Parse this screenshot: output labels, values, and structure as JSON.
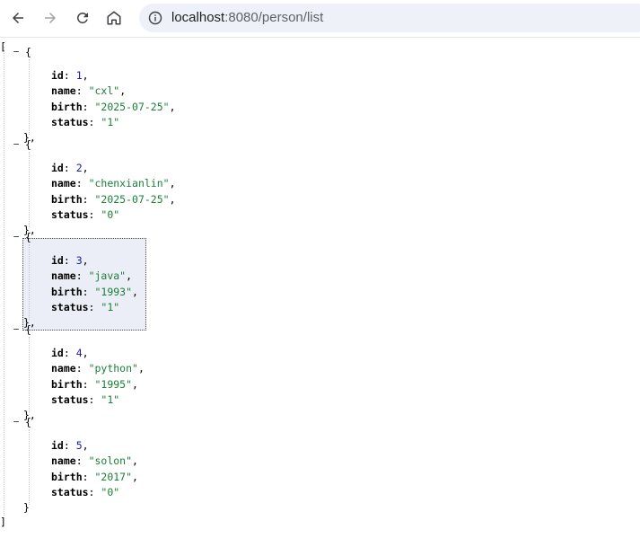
{
  "browser": {
    "url_host": "localhost",
    "url_rest": ":8080/person/list",
    "icons": [
      "back-arrow-icon",
      "forward-arrow-icon",
      "reload-icon",
      "home-icon",
      "site-info-icon"
    ]
  },
  "json": {
    "open_bracket": "[",
    "close_bracket": "]",
    "records": [
      {
        "id": "1",
        "name": "\"cxl\"",
        "birth": "\"2025-07-25\"",
        "status": "\"1\""
      },
      {
        "id": "2",
        "name": "\"chenxianlin\"",
        "birth": "\"2025-07-25\"",
        "status": "\"0\""
      },
      {
        "id": "3",
        "name": "\"java\"",
        "birth": "\"1993\"",
        "status": "\"1\""
      },
      {
        "id": "4",
        "name": "\"python\"",
        "birth": "\"1995\"",
        "status": "\"1\""
      },
      {
        "id": "5",
        "name": "\"solon\"",
        "birth": "\"2017\"",
        "status": "\"0\""
      }
    ],
    "keys": {
      "id": "id",
      "name": "name",
      "birth": "birth",
      "status": "status"
    },
    "toggle_symbol": "−",
    "colors": {
      "key": "#000000",
      "number": "#1a1aa6",
      "string": "#1a7f37",
      "highlight": "#eceef7"
    }
  }
}
